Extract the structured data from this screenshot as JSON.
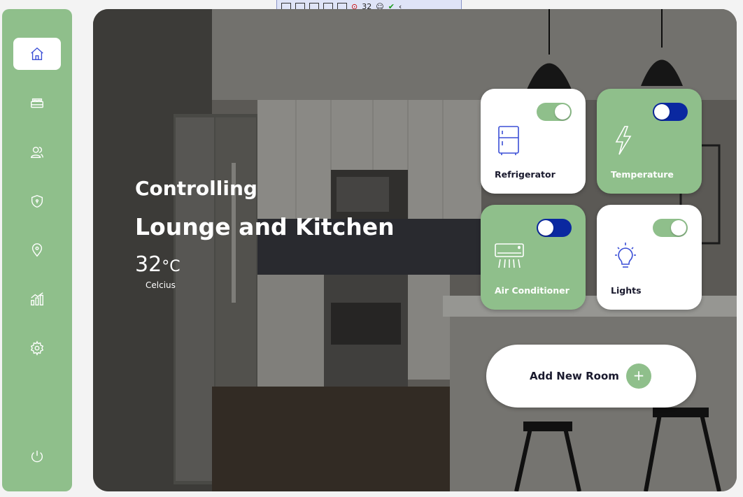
{
  "toolbar": {
    "element_count": "32"
  },
  "sidebar": {
    "items": [
      {
        "icon": "home-icon",
        "active": true
      },
      {
        "icon": "bed-icon"
      },
      {
        "icon": "users-icon"
      },
      {
        "icon": "shield-icon"
      },
      {
        "icon": "location-pin-icon"
      },
      {
        "icon": "chart-icon"
      },
      {
        "icon": "gear-icon"
      },
      {
        "icon": "power-icon"
      }
    ]
  },
  "hero": {
    "controlling": "Controlling",
    "room": "Lounge and Kitchen",
    "temperature_value": "32",
    "temperature_unit": "°C",
    "temperature_caption": "Celcius"
  },
  "devices": [
    {
      "label": "Refrigerator",
      "icon": "refrigerator-icon",
      "on": true,
      "style": "white"
    },
    {
      "label": "Temperature",
      "icon": "lightning-icon",
      "on": false,
      "style": "green"
    },
    {
      "label": "Air Conditioner",
      "icon": "air-conditioner-icon",
      "on": false,
      "style": "green"
    },
    {
      "label": "Lights",
      "icon": "lightbulb-icon",
      "on": true,
      "style": "white"
    }
  ],
  "add_room": {
    "label": "Add New Room",
    "plus": "+"
  },
  "colors": {
    "accent": "#8fbf8b",
    "toggle_off": "#0a28a0",
    "icon_blue": "#3b4fd6"
  }
}
